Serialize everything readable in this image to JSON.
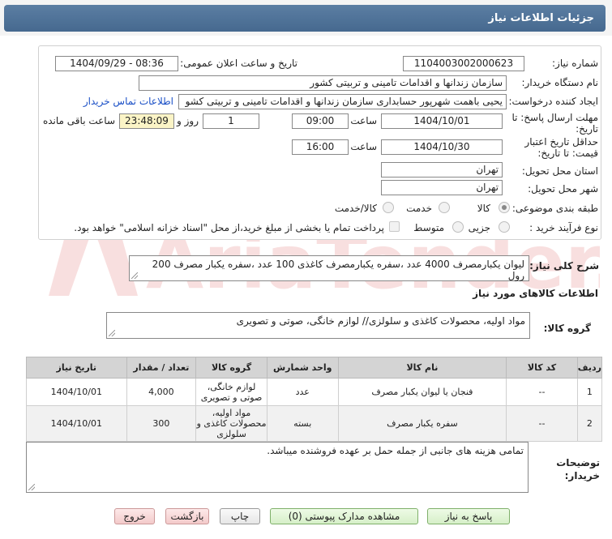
{
  "header": {
    "title": "جزئیات اطلاعات نیاز"
  },
  "form": {
    "need_number": {
      "label": "شماره نیاز:",
      "value": "1104003002000623"
    },
    "announce_datetime": {
      "label": "تاریخ و ساعت اعلان عمومی:",
      "value": "1404/09/29 - 08:36"
    },
    "buyer_org": {
      "label": "نام دستگاه خریدار:",
      "value": "سازمان زندانها و اقدامات تامینی و تربیتی کشور"
    },
    "creator": {
      "label": "ایجاد کننده درخواست:",
      "value": "یحیی باهمت شهرپور حسابداری سازمان زندانها و اقدامات تامینی و تربیتی کشو",
      "contact_link": "اطلاعات تماس خریدار"
    },
    "deadline": {
      "label": "مهلت ارسال پاسخ: تا تاریخ:",
      "date": "1404/10/01",
      "time_label": "ساعت",
      "time": "09:00",
      "days": "1",
      "days_label": "روز و",
      "remaining": "23:48:09",
      "remaining_label": "ساعت باقی مانده"
    },
    "validity": {
      "label": "حداقل تاریخ اعتبار قیمت: تا تاریخ:",
      "date": "1404/10/30",
      "time_label": "ساعت",
      "time": "16:00"
    },
    "province": {
      "label": "استان محل تحویل:",
      "value": "تهران"
    },
    "city": {
      "label": "شهر محل تحویل:",
      "value": "تهران"
    },
    "category": {
      "label": "طبقه بندی موضوعی:",
      "options": [
        "کالا",
        "خدمت",
        "کالا/خدمت"
      ],
      "selected": "کالا"
    },
    "process": {
      "label": "نوع فرآیند خرید :",
      "options": [
        "جزیی",
        "متوسط"
      ],
      "note": "پرداخت تمام یا بخشی از مبلغ خرید،از محل \"اسناد خزانه اسلامی\" خواهد بود."
    }
  },
  "description": {
    "label": "شرح کلی نیاز:",
    "value": "لیوان یکبارمصرف 4000 عدد ،سفره یکبارمصرف کاغذی 100  عدد ،سفره یکبار مصرف 200 رول"
  },
  "goods_info_title": "اطلاعات کالاهای مورد نیاز",
  "goods_group": {
    "label": "گروه کالا:",
    "value": "مواد اولیه، محصولات کاغذی و سلولزی// لوازم خانگی، صوتی و تصویری"
  },
  "table": {
    "headers": [
      "ردیف",
      "کد کالا",
      "نام کالا",
      "واحد شمارش",
      "گروه کالا",
      "تعداد / مقدار",
      "تاریخ نیاز"
    ],
    "rows": [
      {
        "index": "1",
        "code": "--",
        "name": "فنجان یا لیوان یکبار مصرف",
        "unit": "عدد",
        "group": "لوازم خانگی، صوتی و تصویری",
        "qty": "4,000",
        "date": "1404/10/01"
      },
      {
        "index": "2",
        "code": "--",
        "name": "سفره یکبار مصرف",
        "unit": "بسته",
        "group": "مواد اولیه، محصولات کاغذی و سلولزی",
        "qty": "300",
        "date": "1404/10/01"
      }
    ]
  },
  "buyer_notes": {
    "label": "توضیحات خریدار:",
    "value": "تمامی هزینه های جانبی از جمله حمل بر عهده فروشنده میباشد."
  },
  "buttons": {
    "reply": "پاسخ به نیاز",
    "attachments": "مشاهده مدارک پیوستی (0)",
    "print": "چاپ",
    "back": "بازگشت",
    "exit": "خروج"
  },
  "watermark_text": "AriaTender.neT"
}
